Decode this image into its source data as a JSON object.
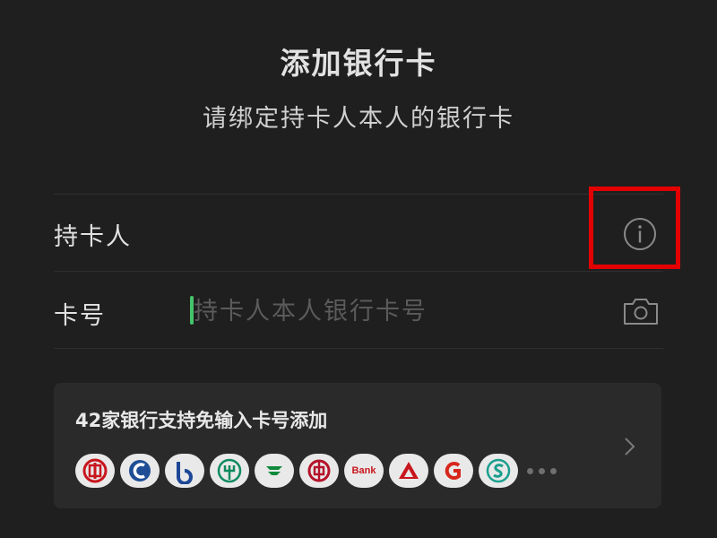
{
  "header": {
    "title": "添加银行卡",
    "subtitle": "请绑定持卡人本人的银行卡"
  },
  "form": {
    "cardholder_label": "持卡人",
    "card_number_label": "卡号",
    "card_number_placeholder": "持卡人本人银行卡号",
    "card_number_value": ""
  },
  "banks": {
    "promo_text": "42家银行支持免输入卡号添加",
    "logo_text_bank": "Bank",
    "logos": [
      {
        "name": "icbc",
        "color": "#c8161d"
      },
      {
        "name": "ccb",
        "color": "#1f4e96"
      },
      {
        "name": "bocom",
        "color": "#1d4796"
      },
      {
        "name": "abc",
        "color": "#0f8a5f"
      },
      {
        "name": "psbc",
        "color": "#0f8a3c"
      },
      {
        "name": "boc",
        "color": "#b4122a"
      },
      {
        "name": "bank-generic",
        "color": "#c8161d"
      },
      {
        "name": "cmb-red-triangle",
        "color": "#c8161d"
      },
      {
        "name": "cgb",
        "color": "#d7261b"
      },
      {
        "name": "spdb",
        "color": "#1b9f8e"
      }
    ]
  },
  "colors": {
    "background": "#1f1f1f",
    "highlight": "#e30000",
    "cursor": "#45c46a"
  }
}
